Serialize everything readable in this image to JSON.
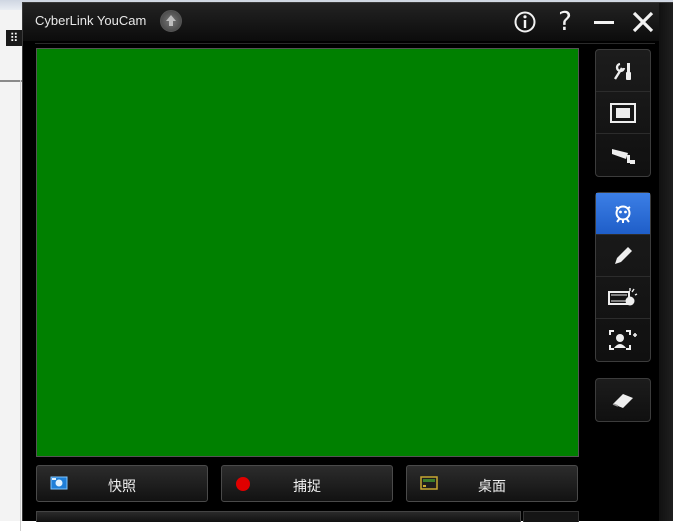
{
  "window": {
    "title": "CyberLink YouCam"
  },
  "titlebar": {
    "help_label": "?"
  },
  "tools": {
    "group1": [
      {
        "name": "settings-tools",
        "icon": "wrench-screwdriver-icon"
      },
      {
        "name": "fullscreen",
        "icon": "fullscreen-icon"
      },
      {
        "name": "surveillance",
        "icon": "security-camera-icon"
      }
    ],
    "group2": [
      {
        "name": "effects",
        "icon": "creature-icon",
        "active": true
      },
      {
        "name": "draw",
        "icon": "pencil-icon"
      },
      {
        "name": "video-effects",
        "icon": "film-bulb-icon"
      },
      {
        "name": "face-tracking",
        "icon": "add-person-icon"
      }
    ],
    "group3": [
      {
        "name": "eraser",
        "icon": "eraser-icon"
      }
    ]
  },
  "buttons": {
    "snapshot_label": "快照",
    "capture_label": "捕捉",
    "desktop_label": "桌面"
  },
  "colors": {
    "preview_bg": "#008000",
    "active_tool": "#2f6fdc",
    "record_dot": "#e00000",
    "snapshot_icon": "#2a8fe0"
  }
}
